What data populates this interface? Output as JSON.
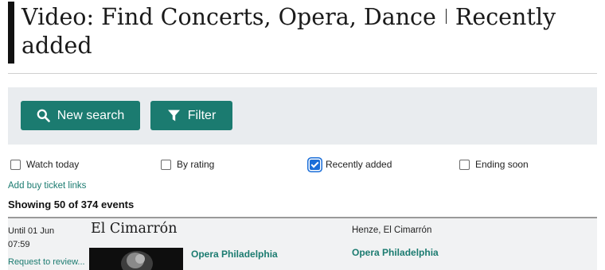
{
  "header": {
    "title_main": "Video: Find Concerts, Opera, Dance",
    "title_sub": "Recently added"
  },
  "toolbar": {
    "new_search_label": "New search",
    "filter_label": "Filter",
    "accent_color": "#1b7b70"
  },
  "filters": [
    {
      "label": "Watch today",
      "checked": false
    },
    {
      "label": "By rating",
      "checked": false
    },
    {
      "label": "Recently added",
      "checked": true
    },
    {
      "label": "Ending soon",
      "checked": false
    }
  ],
  "buy_links_label": "Add buy ticket links",
  "results": {
    "summary": "Showing 50 of 374 events"
  },
  "events": [
    {
      "until": "Until 01 Jun",
      "time": "07:59",
      "review_link": "Request to review...",
      "title": "El Cimarrón",
      "venue": "Opera Philadelphia",
      "work": "Henze, El Cimarrón",
      "company": "Opera Philadelphia"
    }
  ]
}
